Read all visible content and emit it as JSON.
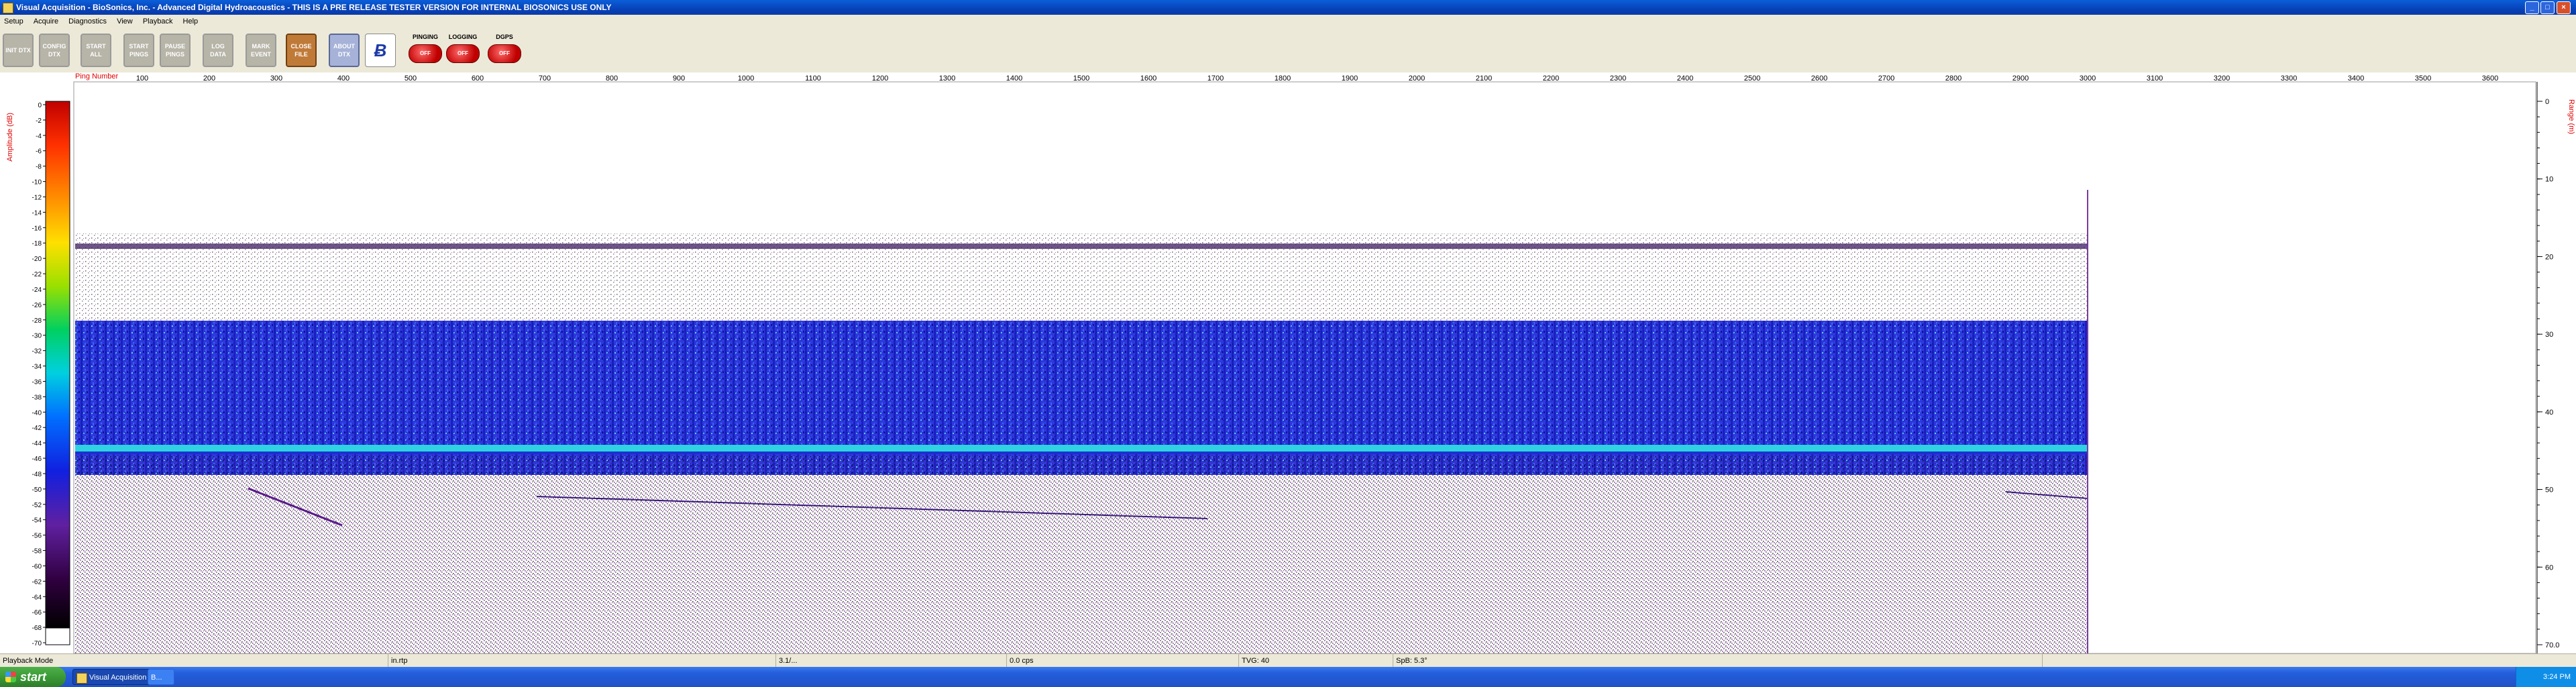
{
  "window": {
    "title": "Visual Acquisition  -  BioSonics, Inc.  -  Advanced Digital Hydroacoustics  -  THIS IS A PRE RELEASE TESTER VERSION FOR INTERNAL BIOSONICS USE ONLY",
    "minimize": "_",
    "maximize": "□",
    "close": "×"
  },
  "menu": [
    "Setup",
    "Acquire",
    "Diagnostics",
    "View",
    "Playback",
    "Help"
  ],
  "toolbar": {
    "buttons": [
      {
        "label": "INIT DTX"
      },
      {
        "label": "CONFIG DTX"
      },
      {
        "label": "START ALL"
      },
      {
        "label": "START PINGS"
      },
      {
        "label": "PAUSE PINGS"
      },
      {
        "label": "LOG DATA"
      },
      {
        "label": "MARK EVENT"
      },
      {
        "label": "CLOSE FILE"
      },
      {
        "label": "ABOUT DTX"
      }
    ],
    "logo_glyph": "Ƀ",
    "status": [
      {
        "label": "PINGING",
        "value": "OFF"
      },
      {
        "label": "LOGGING",
        "value": "OFF"
      },
      {
        "label": "DGPS",
        "value": "OFF"
      }
    ]
  },
  "echogram": {
    "x_axis_title": "Ping Number",
    "x_ticks": [
      "100",
      "200",
      "300",
      "400",
      "500",
      "600",
      "700",
      "800",
      "900",
      "1000",
      "1100",
      "1200",
      "1300",
      "1400",
      "1500",
      "1600",
      "1700",
      "1800",
      "1900",
      "2000",
      "2100",
      "2200",
      "2300",
      "2400",
      "2500",
      "2600",
      "2700",
      "2800",
      "2900",
      "3000",
      "3100",
      "3200",
      "3300",
      "3400",
      "3500",
      "3600"
    ],
    "color_scale_title": "Amplitude (dB)",
    "color_scale_ticks": [
      "0",
      "-2",
      "-4",
      "-6",
      "-8",
      "-10",
      "-12",
      "-14",
      "-16",
      "-18",
      "-20",
      "-22",
      "-24",
      "-26",
      "-28",
      "-30",
      "-32",
      "-34",
      "-36",
      "-38",
      "-40",
      "-42",
      "-44",
      "-46",
      "-48",
      "-50",
      "-52",
      "-54",
      "-56",
      "-58",
      "-60",
      "-62",
      "-64",
      "-66",
      "-68",
      "-70"
    ],
    "range_title": "Range (m)",
    "range_ticks": [
      "0",
      "10",
      "20",
      "30",
      "40",
      "50",
      "60",
      "70.0"
    ],
    "last_ping": 3000
  },
  "statusbar": {
    "mode": "Playback Mode",
    "cells": [
      "in.rtp",
      "3.1/...",
      "0.0 cps",
      "TVG: 40",
      "SpB: 5.3°"
    ]
  },
  "taskbar": {
    "start": "start",
    "tasks": [
      "Visual Acquisition",
      "B..."
    ],
    "clock": "3:24 PM"
  }
}
